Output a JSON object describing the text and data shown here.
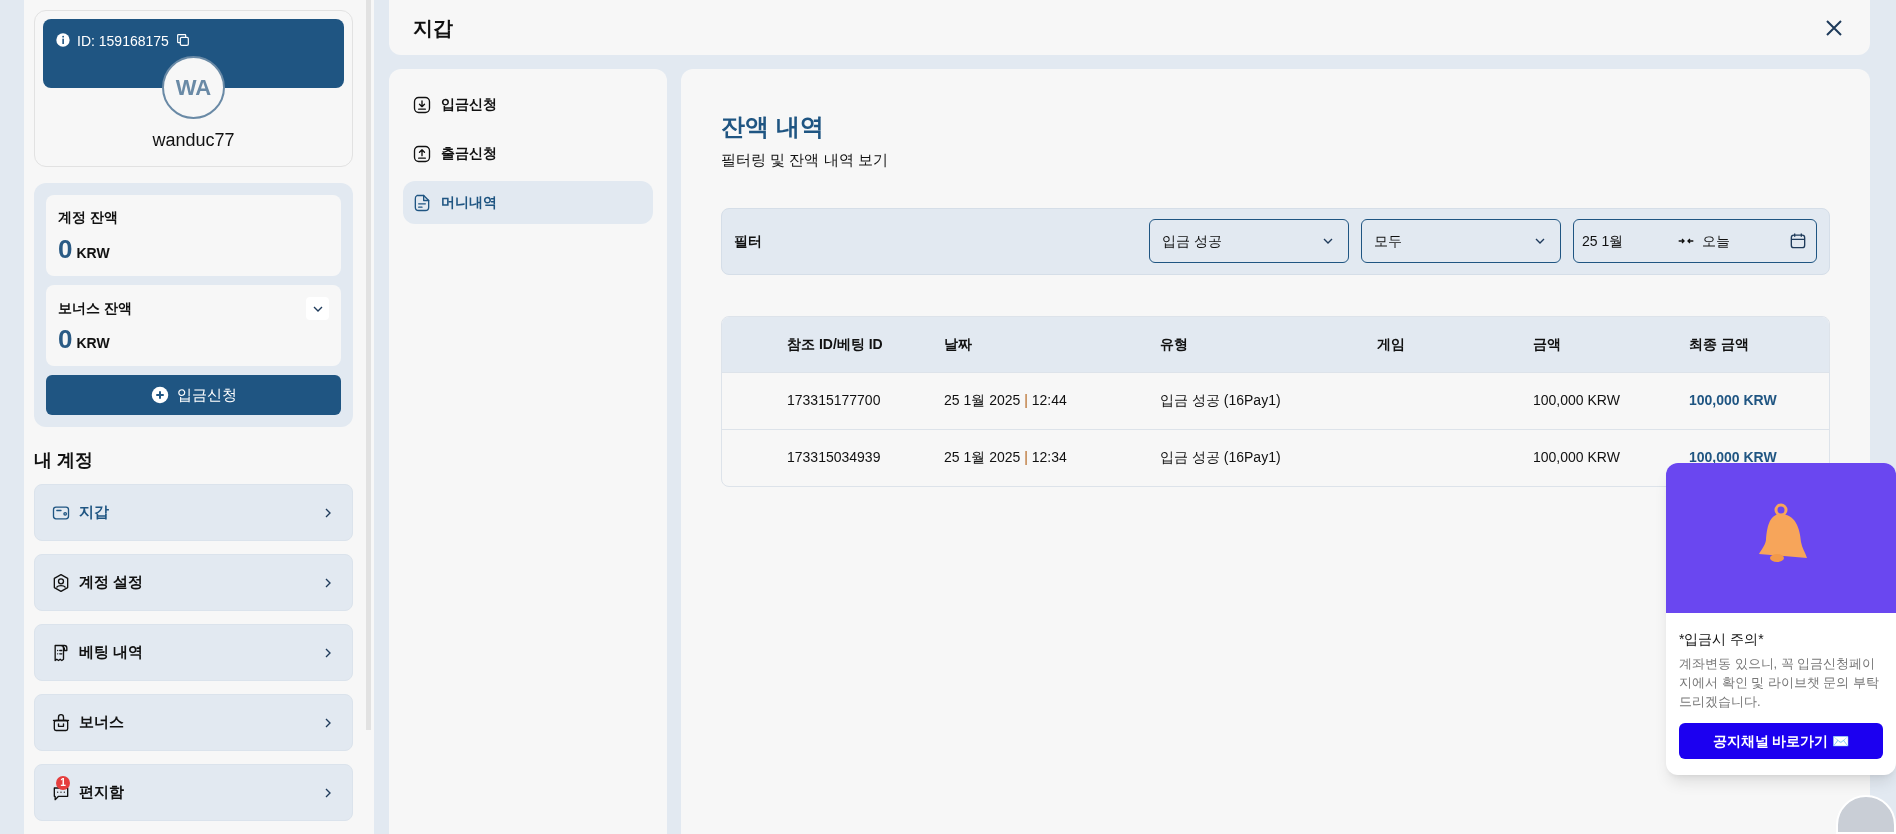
{
  "profile": {
    "id_label": "ID: 159168175",
    "initials": "WA",
    "username": "wanduc77"
  },
  "balances": [
    {
      "label": "계정 잔액",
      "amount": "0",
      "currency": "KRW",
      "expandable": false
    },
    {
      "label": "보너스 잔액",
      "amount": "0",
      "currency": "KRW",
      "expandable": true
    }
  ],
  "deposit_button": "입금신청",
  "account_section": {
    "title": "내 계정",
    "items": [
      {
        "label": "지갑",
        "kind": "wallet",
        "selected": true
      },
      {
        "label": "계정 설정",
        "kind": "user",
        "selected": false
      },
      {
        "label": "베팅 내역",
        "kind": "receipt",
        "selected": false
      },
      {
        "label": "보너스",
        "kind": "gift",
        "selected": false
      },
      {
        "label": "편지함",
        "kind": "chat",
        "selected": false,
        "badge": "1"
      }
    ]
  },
  "header": {
    "title": "지갑"
  },
  "wallet_menu": [
    {
      "label": "입금신청",
      "kind": "download",
      "selected": false
    },
    {
      "label": "출금신청",
      "kind": "upload",
      "selected": false
    },
    {
      "label": "머니내역",
      "kind": "document",
      "selected": true
    }
  ],
  "content": {
    "title": "잔액 내역",
    "subtitle": "필터링 및 잔액 내역 보기"
  },
  "filter": {
    "label": "필터",
    "status": "입금 성공",
    "type": "모두",
    "date_from": "25 1월",
    "date_to": "오늘"
  },
  "table": {
    "columns": [
      "참조 ID/베팅 ID",
      "날짜",
      "유형",
      "게임",
      "금액",
      "최종 금액"
    ],
    "rows": [
      {
        "ref": "173315177700",
        "date": "25 1월 2025",
        "separator": "|",
        "time": "12:44",
        "type": "입금 성공 (16Pay1)",
        "amount": "100,000 KRW",
        "final": "100,000 KRW"
      },
      {
        "ref": "173315034939",
        "date": "25 1월 2025",
        "separator": "|",
        "time": "12:34",
        "type": "입금 성공 (16Pay1)",
        "amount": "100,000 KRW",
        "final": "100,000 KRW"
      }
    ]
  },
  "notice": {
    "title": "*입금시 주의*",
    "body": "계좌변동 있으니, 꼭 입금신청페이지에서 확인 및 라이브챗 문의 부탁드리겠습니다.",
    "button": "공지채널 바로가기 ✉️"
  }
}
